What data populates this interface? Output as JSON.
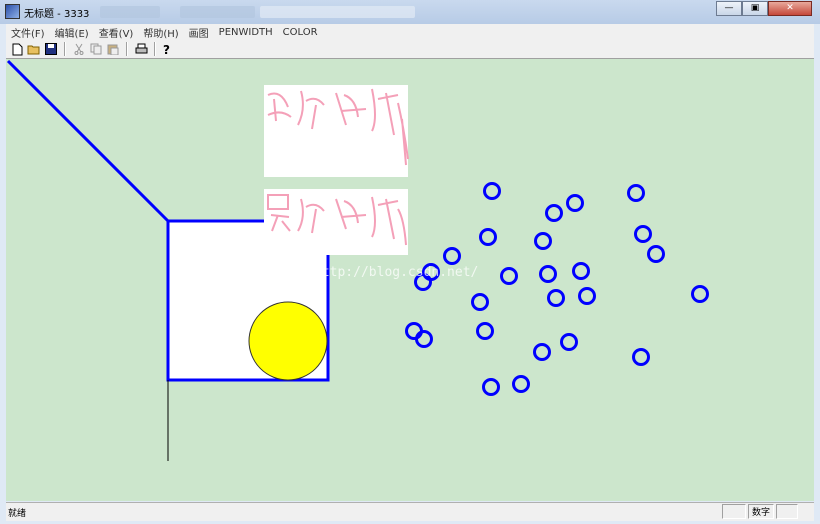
{
  "window": {
    "title": "无标题 - 3333"
  },
  "menubar": {
    "items": [
      "文件(F)",
      "编辑(E)",
      "查看(V)",
      "帮助(H)",
      "画图",
      "PENWIDTH",
      "COLOR"
    ]
  },
  "toolbar": {
    "buttons": [
      "new-file-icon",
      "open-folder-icon",
      "save-icon",
      "cut-icon",
      "copy-icon",
      "paste-icon",
      "print-icon",
      "help-icon"
    ]
  },
  "canvas": {
    "background": "#cce6cc",
    "line_color": "#0000ff",
    "circle_fill": "#ffff00",
    "watermark": "http://blog.csdn.net/"
  },
  "statusbar": {
    "text": "就绪",
    "indicator": "数字"
  }
}
